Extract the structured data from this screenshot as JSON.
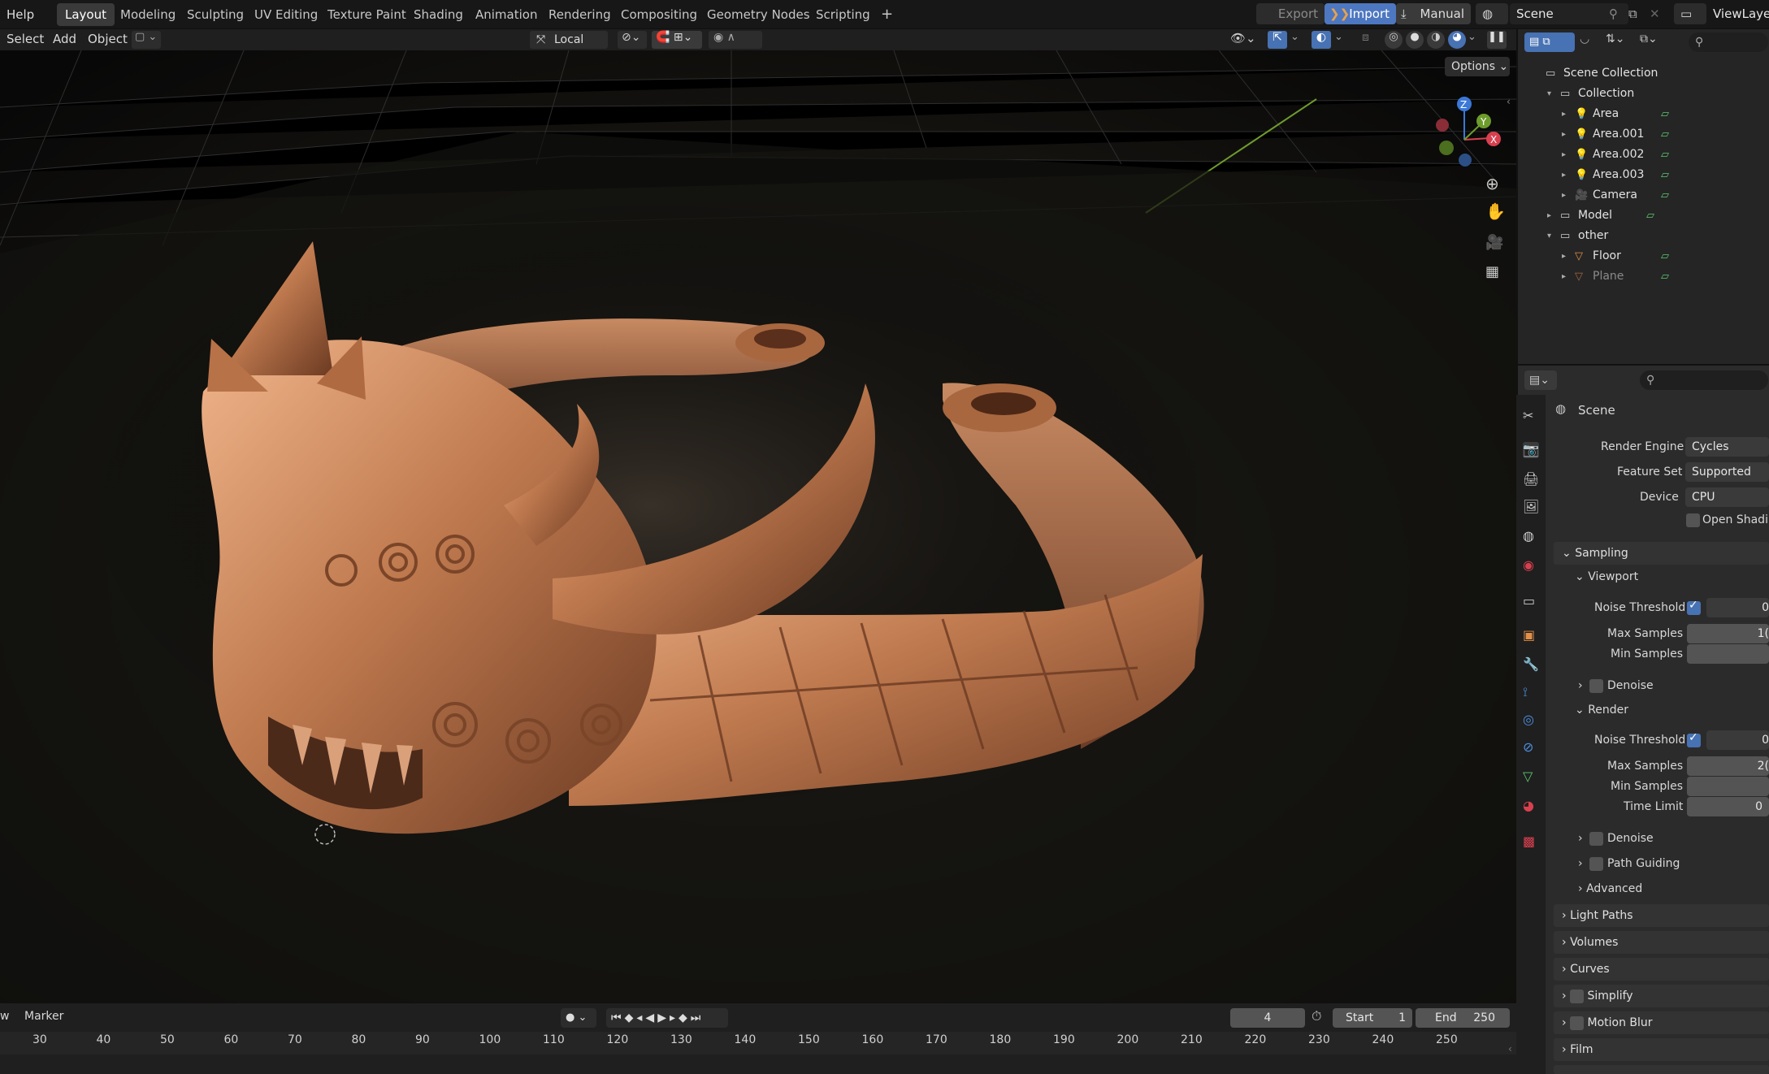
{
  "topbar": {
    "help": "Help",
    "tabs": [
      "Layout",
      "Modeling",
      "Sculpting",
      "UV Editing",
      "Texture Paint",
      "Shading",
      "Animation",
      "Rendering",
      "Compositing",
      "Geometry Nodes",
      "Scripting"
    ],
    "add_tab": "+",
    "export": "Export",
    "import": "Import",
    "manual": "Manual",
    "scene": "Scene",
    "viewlayer": "ViewLayer"
  },
  "vpheader": {
    "select": "Select",
    "add": "Add",
    "object": "Object",
    "orientation": "Local",
    "options": "Options"
  },
  "outliner": {
    "rows": [
      {
        "label": "Scene Collection",
        "depth": 0
      },
      {
        "label": "Collection",
        "depth": 1
      },
      {
        "label": "Area",
        "depth": 2
      },
      {
        "label": "Area.001",
        "depth": 2
      },
      {
        "label": "Area.002",
        "depth": 2
      },
      {
        "label": "Area.003",
        "depth": 2
      },
      {
        "label": "Camera",
        "depth": 2
      },
      {
        "label": "Model",
        "depth": 1
      },
      {
        "label": "other",
        "depth": 1
      },
      {
        "label": "Floor",
        "depth": 2
      },
      {
        "label": "Plane",
        "depth": 2
      }
    ]
  },
  "properties": {
    "title": "Scene",
    "render_engine_label": "Render Engine",
    "render_engine": "Cycles",
    "feature_set_label": "Feature Set",
    "feature_set": "Supported",
    "device_label": "Device",
    "device": "CPU",
    "open_shading": "Open Shadin",
    "sampling": "Sampling",
    "viewport": "Viewport",
    "noise_threshold": "Noise Threshold",
    "noise_val": "0",
    "max_samples": "Max Samples",
    "max_val_vp": "1(",
    "min_samples": "Min Samples",
    "denoise": "Denoise",
    "render": "Render",
    "max_val_r": "2(",
    "time_limit": "Time Limit",
    "time_val": "0",
    "path_guiding": "Path Guiding",
    "advanced": "Advanced",
    "panels": [
      "Light Paths",
      "Volumes",
      "Curves",
      "Simplify",
      "Motion Blur",
      "Film"
    ]
  },
  "timeline": {
    "view": "w",
    "marker": "Marker",
    "frame": "4",
    "start_label": "Start",
    "start": "1",
    "end_label": "End",
    "end": "250",
    "ticks": [
      "30",
      "40",
      "50",
      "60",
      "70",
      "80",
      "90",
      "100",
      "110",
      "120",
      "130",
      "140",
      "150",
      "160",
      "170",
      "180",
      "190",
      "200",
      "210",
      "220",
      "230",
      "240",
      "250"
    ]
  },
  "colors": {
    "accent": "#4772b3",
    "copper": "#c07a4f",
    "import": "#4d77c0"
  }
}
